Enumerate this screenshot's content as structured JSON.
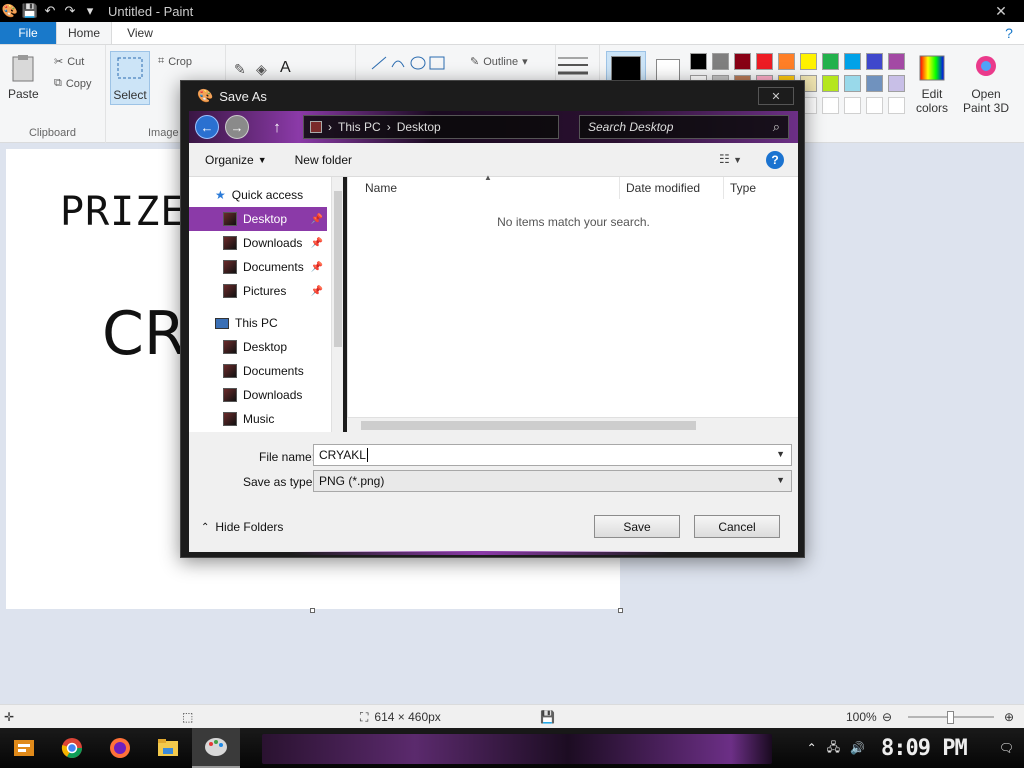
{
  "paint": {
    "window_title": "Untitled - Paint",
    "tabs": {
      "file": "File",
      "home": "Home",
      "view": "View"
    },
    "ribbon": {
      "clipboard": {
        "paste": "Paste",
        "cut": "Cut",
        "copy": "Copy",
        "group_label": "Clipboard"
      },
      "image": {
        "select": "Select",
        "crop": "Crop",
        "group_label": "Image"
      },
      "shapes": {
        "outline": "Outline"
      },
      "colors": {
        "edit_colors": "Edit colors",
        "open_paint3d": "Open Paint 3D",
        "palette_row1": [
          "#000000",
          "#7f7f7f",
          "#880015",
          "#ed1c24",
          "#ff7f27",
          "#fff200",
          "#22b14c",
          "#00a2e8",
          "#3f48cc",
          "#a349a4"
        ],
        "palette_row2": [
          "#ffffff",
          "#c3c3c3",
          "#b97a57",
          "#ffaec9",
          "#ffc90e",
          "#efe4b0",
          "#b5e61d",
          "#99d9ea",
          "#7092be",
          "#c8bfe7"
        ],
        "color1": "#000000",
        "color2": "#ffffff"
      }
    },
    "canvas": {
      "line1": "PRIZE",
      "line2": "CRY"
    },
    "status": {
      "size": "614 × 460px",
      "zoom": "100%",
      "zoom_level": 0.5
    }
  },
  "dialog": {
    "title": "Save As",
    "breadcrumb": [
      "This PC",
      "Desktop"
    ],
    "search_placeholder": "Search Desktop",
    "toolbar": {
      "organize": "Organize",
      "new_folder": "New folder"
    },
    "nav": {
      "quick_access": "Quick access",
      "quick_items": [
        "Desktop",
        "Downloads",
        "Documents",
        "Pictures"
      ],
      "this_pc": "This PC",
      "pc_items": [
        "Desktop",
        "Documents",
        "Downloads",
        "Music"
      ]
    },
    "columns": [
      "Name",
      "Date modified",
      "Type"
    ],
    "empty_message": "No items match your search.",
    "file_name_label": "File name:",
    "file_name_value": "CRYAKL",
    "save_type_label": "Save as type:",
    "save_type_value": "PNG (*.png)",
    "hide_folders": "Hide Folders",
    "save_button": "Save",
    "cancel_button": "Cancel"
  },
  "taskbar": {
    "clock": "8:09 PM"
  }
}
